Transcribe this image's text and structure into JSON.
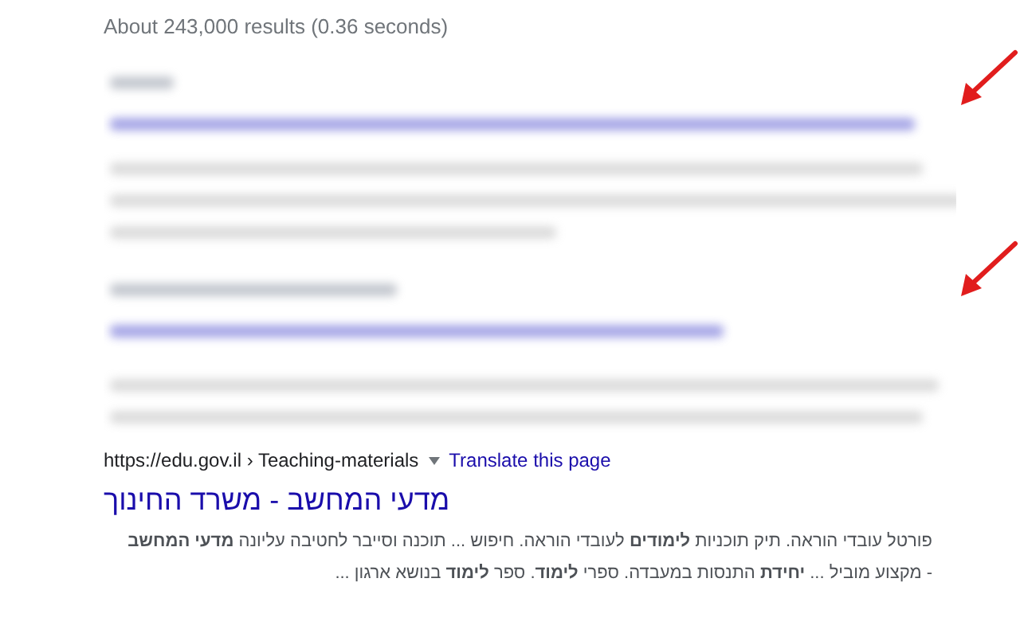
{
  "stats": "About 243,000 results (0.36 seconds)",
  "result": {
    "url": "https://edu.gov.il › Teaching-materials",
    "translate": "Translate this page",
    "title": "מדעי המחשב - משרד החינוך",
    "snippet_lines": [
      "פורטל עובדי הוראה. תיק תוכניות **לימודים** לעובדי הוראה. חיפוש ... תוכנה וסייבר לחטיבה עליונה **מדעי המחשב**",
      "- מקצוע מוביל ... **יחידת** התנסות במעבדה. ספרי **לימוד**. ספר **לימוד** בנושא ארגון ..."
    ]
  }
}
